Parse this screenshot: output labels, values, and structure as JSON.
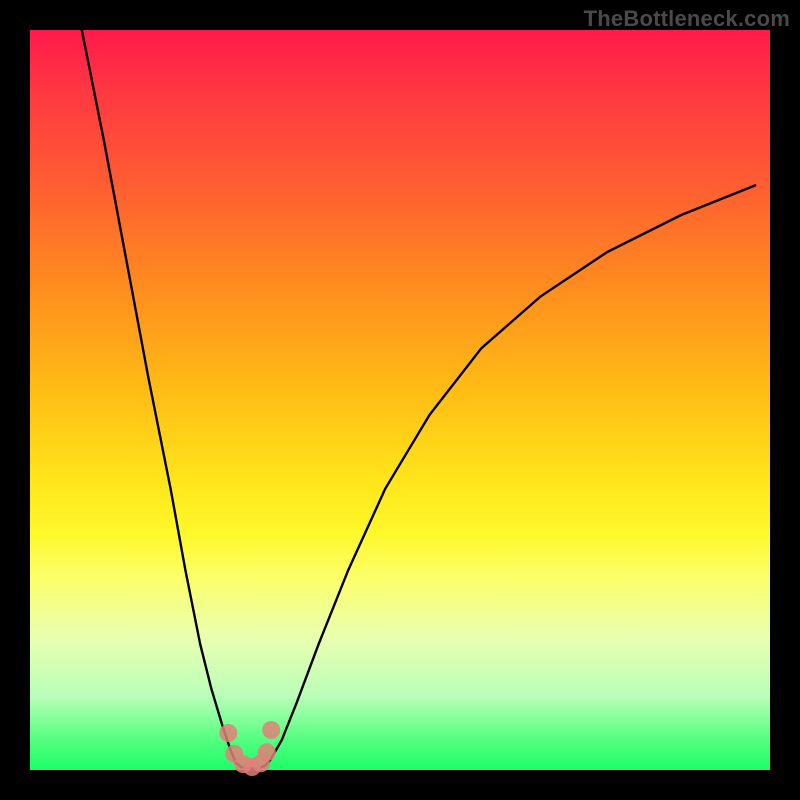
{
  "watermark": "TheBottleneck.com",
  "colors": {
    "frame": "#000000",
    "curve": "#000000",
    "marker_fill": "#e08078",
    "marker_stroke": "#e08078",
    "gradient_top": "#ff1a4b",
    "gradient_bottom": "#1aff6a"
  },
  "chart_data": {
    "type": "line",
    "title": "",
    "xlabel": "",
    "ylabel": "",
    "xlim": [
      0,
      100
    ],
    "ylim": [
      0,
      100
    ],
    "grid": false,
    "legend": false,
    "note": "Axes are unlabeled in the image; x/y treated as 0–100 generic scale. y=0 is the green bottom edge, y=100 the red top. Values are visual estimates off the plot.",
    "series": [
      {
        "name": "left-branch",
        "x": [
          7,
          10,
          13,
          16,
          19,
          21,
          23,
          24.5,
          26,
          27,
          27.8
        ],
        "y": [
          100,
          85,
          69,
          53,
          38,
          27,
          17,
          11,
          6,
          3,
          1
        ]
      },
      {
        "name": "valley",
        "x": [
          27.8,
          28.5,
          29.3,
          30.2,
          31.0,
          31.8,
          32.5
        ],
        "y": [
          1,
          0.4,
          0.2,
          0.2,
          0.3,
          0.6,
          1.4
        ]
      },
      {
        "name": "right-branch",
        "x": [
          32.5,
          34,
          36,
          39,
          43,
          48,
          54,
          61,
          69,
          78,
          88,
          98
        ],
        "y": [
          1.4,
          4,
          9,
          17,
          27,
          38,
          48,
          57,
          64,
          70,
          75,
          79
        ]
      }
    ],
    "markers": {
      "name": "valley-points",
      "x": [
        26.8,
        27.6,
        28.8,
        30.0,
        31.2,
        32.0,
        32.6
      ],
      "y": [
        5.0,
        2.2,
        0.8,
        0.4,
        0.9,
        2.4,
        5.4
      ]
    }
  }
}
